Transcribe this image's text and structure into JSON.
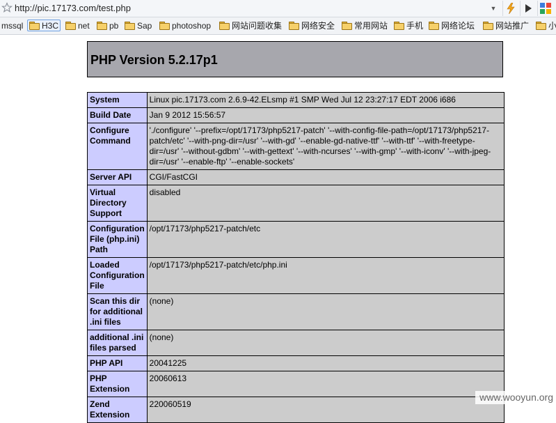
{
  "browser": {
    "url": "http://pic.17173.com/test.php",
    "icons": {
      "star": "star-icon",
      "dropdown": "chevron-down-icon",
      "lightning": "lightning-icon",
      "play": "play-icon",
      "extension": "extension-icon"
    },
    "bookmarks": [
      {
        "label": "mssql",
        "folder": false
      },
      {
        "label": "H3C",
        "folder": true,
        "active": true
      },
      {
        "label": "net",
        "folder": true
      },
      {
        "label": "pb",
        "folder": true
      },
      {
        "label": "Sap",
        "folder": true
      },
      {
        "label": "photoshop",
        "folder": true
      },
      {
        "label": "网站问题收集",
        "folder": true
      },
      {
        "label": "网络安全",
        "folder": true
      },
      {
        "label": "常用网站",
        "folder": true
      },
      {
        "label": "手机",
        "folder": true
      },
      {
        "label": "网络论坛",
        "folder": true
      },
      {
        "label": "网站推广",
        "folder": true
      },
      {
        "label": "小",
        "folder": true
      }
    ]
  },
  "php": {
    "version_title": "PHP Version 5.2.17p1",
    "header_color": "#a7a7ad",
    "label_color": "#ccccff",
    "value_color": "#cccccc",
    "rows": [
      {
        "label": "System",
        "value": "Linux pic.17173.com 2.6.9-42.ELsmp #1 SMP Wed Jul 12 23:27:17 EDT 2006 i686"
      },
      {
        "label": "Build Date",
        "value": "Jan 9 2012 15:56:57"
      },
      {
        "label": "Configure Command",
        "value": "'./configure' '--prefix=/opt/17173/php5217-patch' '--with-config-file-path=/opt/17173/php5217-patch/etc' '--with-png-dir=/usr' '--with-gd' '--enable-gd-native-ttf' '--with-ttf' '--with-freetype-dir=/usr' '--without-gdbm' '--with-gettext' '--with-ncurses' '--with-gmp' '--with-iconv' '--with-jpeg-dir=/usr' '--enable-ftp' '--enable-sockets'"
      },
      {
        "label": "Server API",
        "value": "CGI/FastCGI"
      },
      {
        "label": "Virtual Directory Support",
        "value": "disabled"
      },
      {
        "label": "Configuration File (php.ini) Path",
        "value": "/opt/17173/php5217-patch/etc"
      },
      {
        "label": "Loaded Configuration File",
        "value": "/opt/17173/php5217-patch/etc/php.ini"
      },
      {
        "label": "Scan this dir for additional .ini files",
        "value": "(none)"
      },
      {
        "label": "additional .ini files parsed",
        "value": "(none)"
      },
      {
        "label": "PHP API",
        "value": "20041225"
      },
      {
        "label": "PHP Extension",
        "value": "20060613"
      },
      {
        "label": "Zend Extension",
        "value": "220060519"
      }
    ]
  },
  "watermark": "www.wooyun.org"
}
